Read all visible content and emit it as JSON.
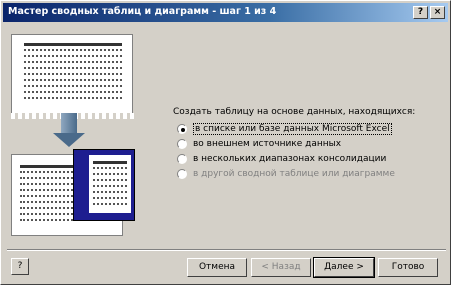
{
  "window": {
    "title": "Мастер сводных таблиц и диаграмм - шаг 1 из 4",
    "help_glyph": "?",
    "close_glyph": "×"
  },
  "source": {
    "prompt": "Создать таблицу на основе данных, находящихся:",
    "options": [
      {
        "label": "в списке или базе данных Microsoft Excel",
        "selected": true,
        "enabled": true
      },
      {
        "label": "во внешнем источнике данных",
        "selected": false,
        "enabled": true
      },
      {
        "label": "в нескольких диапазонах консолидации",
        "selected": false,
        "enabled": true
      },
      {
        "label": "в другой сводной таблице или диаграмме",
        "selected": false,
        "enabled": false
      }
    ]
  },
  "footer": {
    "help_glyph": "?",
    "cancel_label": "Отмена",
    "back_label": "< Назад",
    "next_label": "Далее >",
    "finish_label": "Готово"
  }
}
